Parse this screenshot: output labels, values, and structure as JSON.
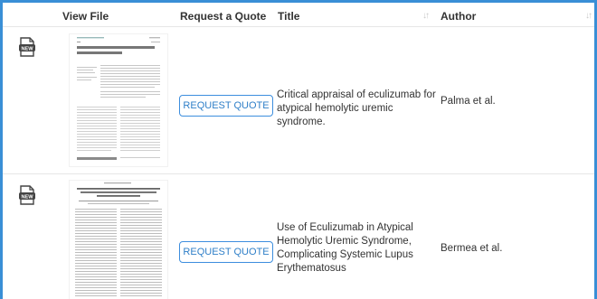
{
  "table": {
    "headers": {
      "view_file": "View File",
      "request_quote": "Request a Quote",
      "title": "Title",
      "author": "Author"
    },
    "rows": [
      {
        "file_badge": "NEW",
        "thumbnail_icon": "document-page-thumbnail",
        "quote_label": "REQUEST QUOTE",
        "title": "Critical appraisal of eculizumab for atypical hemolytic uremic syndrome.",
        "author": "Palma et al."
      },
      {
        "file_badge": "NEW",
        "thumbnail_icon": "document-page-thumbnail",
        "quote_label": "REQUEST QUOTE",
        "title": "Use of Eculizumab in Atypical Hemolytic Uremic Syndrome, Complicating Systemic Lupus Erythematosus",
        "author": "Bermea et al."
      }
    ]
  },
  "colors": {
    "frame_border": "#3a8fd6",
    "button_border": "#3d8ede",
    "button_text": "#2f7fc8"
  }
}
